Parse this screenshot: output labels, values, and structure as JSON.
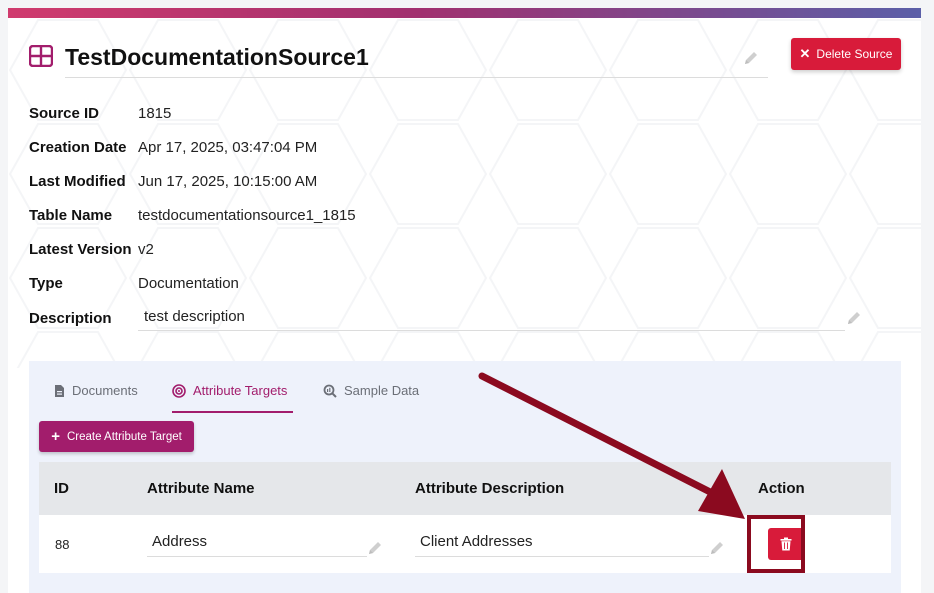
{
  "header": {
    "title": "TestDocumentationSource1",
    "title_icon": "table-grid-icon",
    "delete_button_label": "Delete Source"
  },
  "details": {
    "source_id": {
      "label": "Source ID",
      "value": "1815"
    },
    "creation_date": {
      "label": "Creation Date",
      "value": "Apr 17, 2025, 03:47:04 PM"
    },
    "last_modified": {
      "label": "Last Modified",
      "value": "Jun 17, 2025, 10:15:00 AM"
    },
    "table_name": {
      "label": "Table Name",
      "value": "testdocumentationsource1_1815"
    },
    "latest_version": {
      "label": "Latest Version",
      "value": "v2"
    },
    "type": {
      "label": "Type",
      "value": "Documentation"
    },
    "description": {
      "label": "Description",
      "value": "test description"
    }
  },
  "tabs": [
    {
      "label": "Documents",
      "icon": "document-icon",
      "active": false
    },
    {
      "label": "Attribute Targets",
      "icon": "target-icon",
      "active": true
    },
    {
      "label": "Sample Data",
      "icon": "search-chart-icon",
      "active": false
    }
  ],
  "attribute_targets": {
    "create_button_label": "Create Attribute Target",
    "columns": [
      "ID",
      "Attribute Name",
      "Attribute Description",
      "Action"
    ],
    "rows": [
      {
        "id": "88",
        "name": "Address",
        "description": "Client Addresses",
        "action_icon": "trash-icon"
      }
    ]
  },
  "colors": {
    "accent": "#a21d6c",
    "danger": "#d81b3a",
    "annotation": "#8b0a1f"
  }
}
